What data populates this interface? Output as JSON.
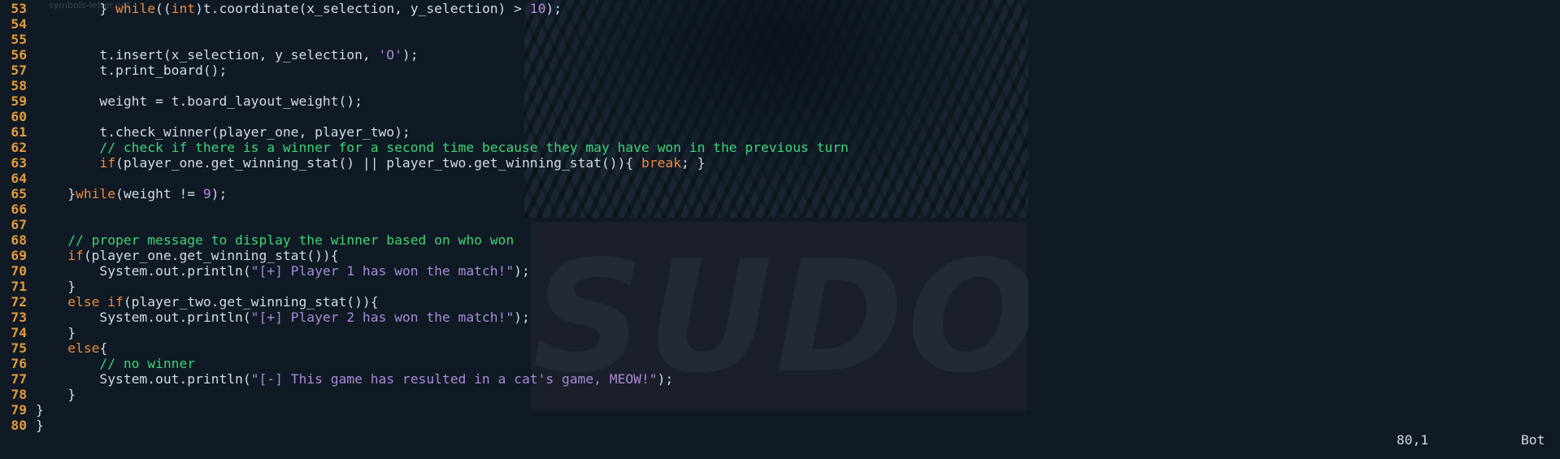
{
  "watermark": "symbols-letter.pdf",
  "wallpaper_text": "SUDO",
  "colors": {
    "background": "#0f1a24",
    "line_number": "#e59a3a",
    "keyword": "#ef8a3b",
    "number": "#b78ae0",
    "string": "#a98ad6",
    "comment": "#3fd37a",
    "text": "#d3dbe3"
  },
  "lines": [
    {
      "n": "53",
      "tokens": [
        {
          "t": "        } ",
          "c": "tx"
        },
        {
          "t": "while",
          "c": "kw"
        },
        {
          "t": "((",
          "c": "tx"
        },
        {
          "t": "int",
          "c": "kw"
        },
        {
          "t": ")t.coordinate(x_selection, y_selection) > ",
          "c": "tx"
        },
        {
          "t": "10",
          "c": "num"
        },
        {
          "t": ");",
          "c": "tx"
        }
      ]
    },
    {
      "n": "54",
      "tokens": []
    },
    {
      "n": "55",
      "tokens": []
    },
    {
      "n": "56",
      "tokens": [
        {
          "t": "        t.insert(x_selection, y_selection, ",
          "c": "tx"
        },
        {
          "t": "'O'",
          "c": "str"
        },
        {
          "t": ");",
          "c": "tx"
        }
      ]
    },
    {
      "n": "57",
      "tokens": [
        {
          "t": "        t.print_board();",
          "c": "tx"
        }
      ]
    },
    {
      "n": "58",
      "tokens": []
    },
    {
      "n": "59",
      "tokens": [
        {
          "t": "        weight = t.board_layout_weight();",
          "c": "tx"
        }
      ]
    },
    {
      "n": "60",
      "tokens": []
    },
    {
      "n": "61",
      "tokens": [
        {
          "t": "        t.check_winner(player_one, player_two);",
          "c": "tx"
        }
      ]
    },
    {
      "n": "62",
      "tokens": [
        {
          "t": "        // check if there is a winner for a second time because they may have won in the previous turn",
          "c": "cm"
        }
      ]
    },
    {
      "n": "63",
      "tokens": [
        {
          "t": "        ",
          "c": "tx"
        },
        {
          "t": "if",
          "c": "kw"
        },
        {
          "t": "(player_one.get_winning_stat() || player_two.get_winning_stat()){ ",
          "c": "tx"
        },
        {
          "t": "break",
          "c": "kw"
        },
        {
          "t": "; }",
          "c": "tx"
        }
      ]
    },
    {
      "n": "64",
      "tokens": []
    },
    {
      "n": "65",
      "tokens": [
        {
          "t": "    }",
          "c": "tx"
        },
        {
          "t": "while",
          "c": "kw"
        },
        {
          "t": "(weight != ",
          "c": "tx"
        },
        {
          "t": "9",
          "c": "num"
        },
        {
          "t": ");",
          "c": "tx"
        }
      ]
    },
    {
      "n": "66",
      "tokens": []
    },
    {
      "n": "67",
      "tokens": []
    },
    {
      "n": "68",
      "tokens": [
        {
          "t": "    // proper message to display the winner based on who won",
          "c": "cm"
        }
      ]
    },
    {
      "n": "69",
      "tokens": [
        {
          "t": "    ",
          "c": "tx"
        },
        {
          "t": "if",
          "c": "kw"
        },
        {
          "t": "(player_one.get_winning_stat()){",
          "c": "tx"
        }
      ]
    },
    {
      "n": "70",
      "tokens": [
        {
          "t": "        System.out.println(",
          "c": "tx"
        },
        {
          "t": "\"[+] Player 1 has won the match!\"",
          "c": "str"
        },
        {
          "t": ");",
          "c": "tx"
        }
      ]
    },
    {
      "n": "71",
      "tokens": [
        {
          "t": "    }",
          "c": "tx"
        }
      ]
    },
    {
      "n": "72",
      "tokens": [
        {
          "t": "    ",
          "c": "tx"
        },
        {
          "t": "else if",
          "c": "kw"
        },
        {
          "t": "(player_two.get_winning_stat()){",
          "c": "tx"
        }
      ]
    },
    {
      "n": "73",
      "tokens": [
        {
          "t": "        System.out.println(",
          "c": "tx"
        },
        {
          "t": "\"[+] Player 2 has won the match!\"",
          "c": "str"
        },
        {
          "t": ");",
          "c": "tx"
        }
      ]
    },
    {
      "n": "74",
      "tokens": [
        {
          "t": "    }",
          "c": "tx"
        }
      ]
    },
    {
      "n": "75",
      "tokens": [
        {
          "t": "    ",
          "c": "tx"
        },
        {
          "t": "else",
          "c": "kw"
        },
        {
          "t": "{",
          "c": "tx"
        }
      ]
    },
    {
      "n": "76",
      "tokens": [
        {
          "t": "        // no winner",
          "c": "cm"
        }
      ]
    },
    {
      "n": "77",
      "tokens": [
        {
          "t": "        System.out.println(",
          "c": "tx"
        },
        {
          "t": "\"[-] This game has resulted in a cat's game, MEOW!\"",
          "c": "str"
        },
        {
          "t": ");",
          "c": "tx"
        }
      ]
    },
    {
      "n": "78",
      "tokens": [
        {
          "t": "    }",
          "c": "tx"
        }
      ]
    },
    {
      "n": "79",
      "tokens": [
        {
          "t": "}",
          "c": "tx"
        }
      ]
    },
    {
      "n": "80",
      "tokens": [
        {
          "t": "}",
          "c": "tx"
        }
      ]
    }
  ],
  "status": {
    "position": "80,1",
    "scroll": "Bot"
  }
}
